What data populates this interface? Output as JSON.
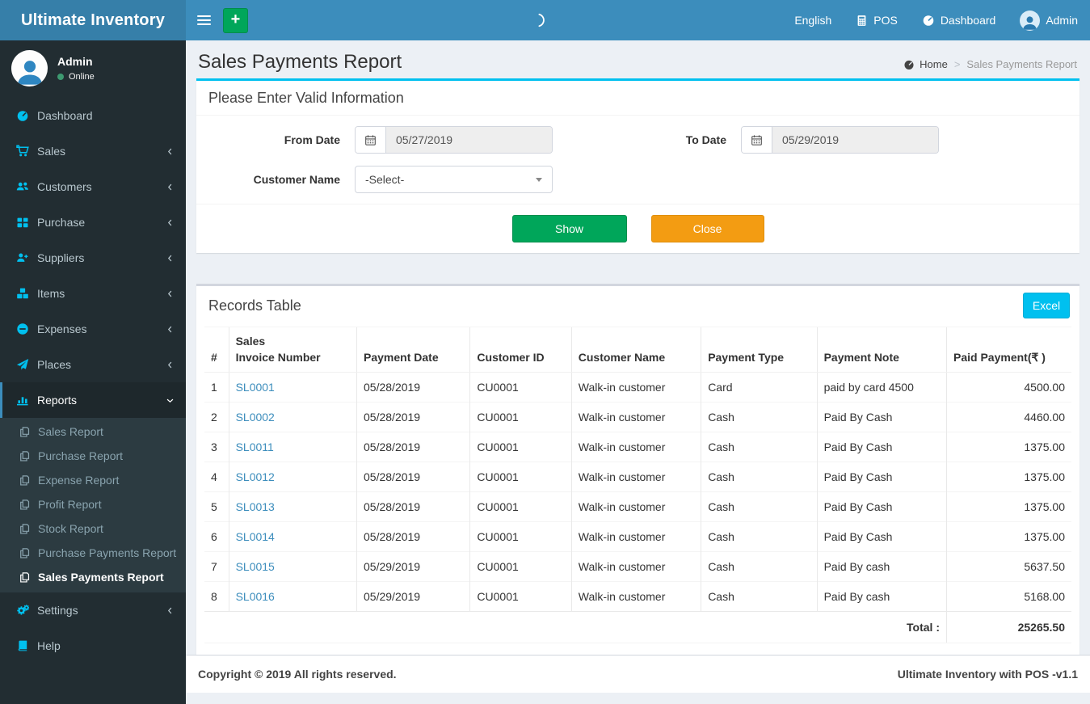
{
  "app": {
    "name": "Ultimate Inventory",
    "footer_left": "Copyright © 2019 All rights reserved.",
    "footer_right": "Ultimate Inventory with POS -v1.1"
  },
  "navbar": {
    "plus_label": "+",
    "language": "English",
    "pos": "POS",
    "dashboard": "Dashboard",
    "user": "Admin"
  },
  "sidebar": {
    "user": {
      "name": "Admin",
      "status": "Online"
    },
    "items": [
      {
        "label": "Dashboard"
      },
      {
        "label": "Sales"
      },
      {
        "label": "Customers"
      },
      {
        "label": "Purchase"
      },
      {
        "label": "Suppliers"
      },
      {
        "label": "Items"
      },
      {
        "label": "Expenses"
      },
      {
        "label": "Places"
      },
      {
        "label": "Reports"
      },
      {
        "label": "Settings"
      },
      {
        "label": "Help"
      }
    ],
    "reports_submenu": [
      "Sales Report",
      "Purchase Report",
      "Expense Report",
      "Profit Report",
      "Stock Report",
      "Purchase Payments Report",
      "Sales Payments Report"
    ],
    "active_item": "Reports",
    "active_subitem": "Sales Payments Report"
  },
  "page": {
    "title": "Sales Payments Report",
    "breadcrumb_home": "Home",
    "breadcrumb_current": "Sales Payments Report"
  },
  "filter": {
    "header": "Please Enter Valid Information",
    "from_date": {
      "label": "From Date",
      "value": "05/27/2019"
    },
    "to_date": {
      "label": "To Date",
      "value": "05/29/2019"
    },
    "customer": {
      "label": "Customer Name",
      "value": "-Select-"
    },
    "show_label": "Show",
    "close_label": "Close"
  },
  "records": {
    "header": "Records Table",
    "excel_label": "Excel",
    "columns": [
      "#",
      "Sales\nInvoice Number",
      "Payment Date",
      "Customer ID",
      "Customer Name",
      "Payment Type",
      "Payment Note",
      "Paid Payment(₹ )"
    ],
    "rows": [
      {
        "no": "1",
        "invoice": "SL0001",
        "payment_date": "05/28/2019",
        "customer_id": "CU0001",
        "customer_name": "Walk-in customer",
        "payment_type": "Card",
        "payment_note": "paid by card 4500",
        "paid_payment": "4500.00"
      },
      {
        "no": "2",
        "invoice": "SL0002",
        "payment_date": "05/28/2019",
        "customer_id": "CU0001",
        "customer_name": "Walk-in customer",
        "payment_type": "Cash",
        "payment_note": "Paid By Cash",
        "paid_payment": "4460.00"
      },
      {
        "no": "3",
        "invoice": "SL0011",
        "payment_date": "05/28/2019",
        "customer_id": "CU0001",
        "customer_name": "Walk-in customer",
        "payment_type": "Cash",
        "payment_note": "Paid By Cash",
        "paid_payment": "1375.00"
      },
      {
        "no": "4",
        "invoice": "SL0012",
        "payment_date": "05/28/2019",
        "customer_id": "CU0001",
        "customer_name": "Walk-in customer",
        "payment_type": "Cash",
        "payment_note": "Paid By Cash",
        "paid_payment": "1375.00"
      },
      {
        "no": "5",
        "invoice": "SL0013",
        "payment_date": "05/28/2019",
        "customer_id": "CU0001",
        "customer_name": "Walk-in customer",
        "payment_type": "Cash",
        "payment_note": "Paid By Cash",
        "paid_payment": "1375.00"
      },
      {
        "no": "6",
        "invoice": "SL0014",
        "payment_date": "05/28/2019",
        "customer_id": "CU0001",
        "customer_name": "Walk-in customer",
        "payment_type": "Cash",
        "payment_note": "Paid By Cash",
        "paid_payment": "1375.00"
      },
      {
        "no": "7",
        "invoice": "SL0015",
        "payment_date": "05/29/2019",
        "customer_id": "CU0001",
        "customer_name": "Walk-in customer",
        "payment_type": "Cash",
        "payment_note": "Paid By cash",
        "paid_payment": "5637.50"
      },
      {
        "no": "8",
        "invoice": "SL0016",
        "payment_date": "05/29/2019",
        "customer_id": "CU0001",
        "customer_name": "Walk-in customer",
        "payment_type": "Cash",
        "payment_note": "Paid By cash",
        "paid_payment": "5168.00"
      }
    ],
    "total_label": "Total :",
    "total_value": "25265.50"
  },
  "colors": {
    "navbar": "#3c8dbc",
    "logo_bg": "#367fa9",
    "sidebar_bg": "#222d32",
    "submenu_bg": "#2c3b41",
    "sidebar_icon": "#00c0ef",
    "info_accent": "#00c0ef",
    "success": "#00a65a",
    "warning": "#f39c12",
    "link": "#3c8dbc",
    "content_bg": "#ecf0f5",
    "online_dot": "#3d9970"
  }
}
